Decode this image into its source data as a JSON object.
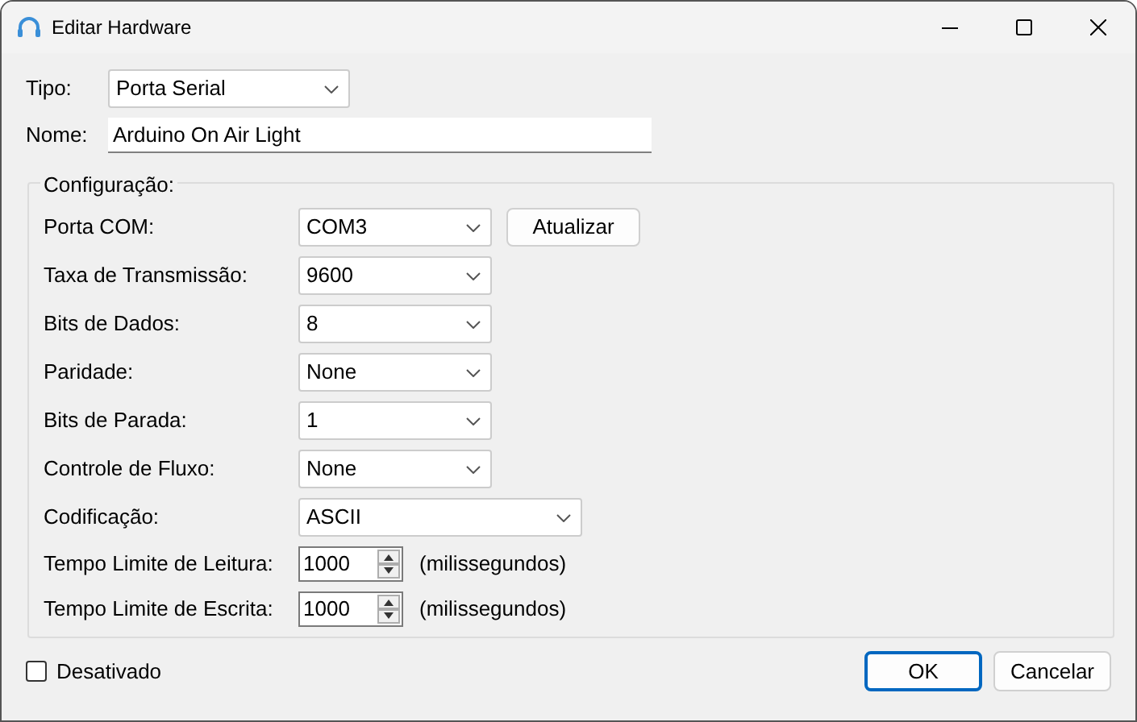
{
  "window": {
    "title": "Editar Hardware"
  },
  "tipo": {
    "label": "Tipo:",
    "value": "Porta Serial"
  },
  "nome": {
    "label": "Nome:",
    "value": "Arduino On Air Light"
  },
  "config": {
    "title": "Configuração:",
    "rows": [
      {
        "kind": "combo",
        "label": "Porta COM:",
        "value": "COM3",
        "button": "Atualizar"
      },
      {
        "kind": "combo",
        "label": "Taxa de Transmissão:",
        "value": "9600"
      },
      {
        "kind": "combo",
        "label": "Bits de Dados:",
        "value": "8"
      },
      {
        "kind": "combo",
        "label": "Paridade:",
        "value": "None"
      },
      {
        "kind": "combo",
        "label": "Bits de Parada:",
        "value": "1"
      },
      {
        "kind": "combo",
        "label": "Controle de Fluxo:",
        "value": "None"
      },
      {
        "kind": "wide-combo",
        "label": "Codificação:",
        "value": "ASCII"
      },
      {
        "kind": "spin",
        "label": "Tempo Limite de Leitura:",
        "value": "1000",
        "unit": "(milissegundos)"
      },
      {
        "kind": "spin",
        "label": "Tempo Limite de Escrita:",
        "value": "1000",
        "unit": "(milissegundos)"
      }
    ]
  },
  "disabled": {
    "label": "Desativado",
    "checked": false
  },
  "buttons": [
    {
      "label": "OK",
      "selected": true
    },
    {
      "label": "Cancelar",
      "selected": false
    }
  ]
}
